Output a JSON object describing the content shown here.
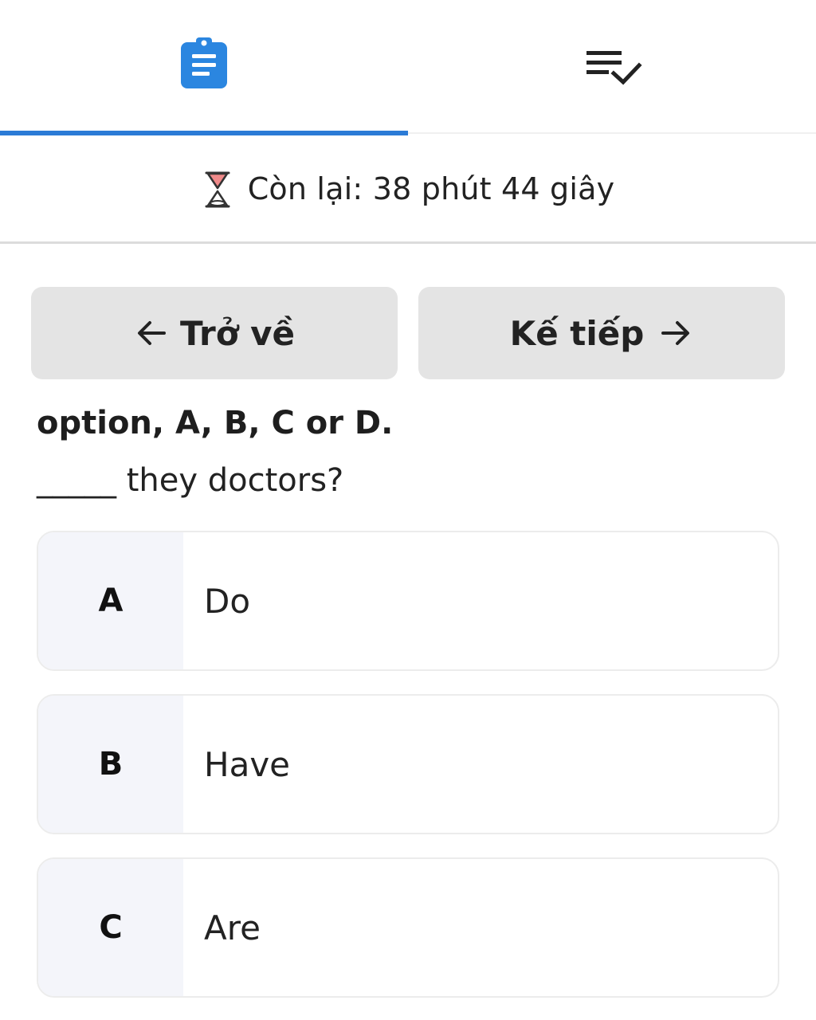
{
  "tabs": [
    {
      "name": "questions",
      "icon": "clipboard-icon",
      "active": true
    },
    {
      "name": "review",
      "icon": "playlist-check-icon",
      "active": false
    }
  ],
  "accent_color": "#2b7bd6",
  "timer": {
    "icon": "hourglass-icon",
    "label": "Còn lại: 38 phút 44 giây"
  },
  "navigation": {
    "back_label": "Trở về",
    "next_label": "Kế tiếp"
  },
  "question": {
    "instruction": "option, A, B, C or D.",
    "text": "_____ they doctors?",
    "options": [
      {
        "letter": "A",
        "text": "Do"
      },
      {
        "letter": "B",
        "text": "Have"
      },
      {
        "letter": "C",
        "text": "Are"
      }
    ]
  }
}
